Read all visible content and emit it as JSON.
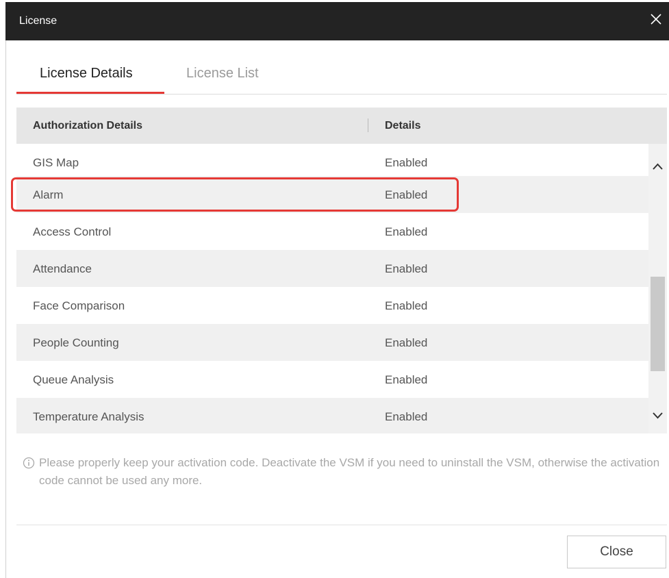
{
  "dialog": {
    "title": "License"
  },
  "tabs": [
    {
      "label": "License Details",
      "active": true
    },
    {
      "label": "License List",
      "active": false
    }
  ],
  "table": {
    "headers": [
      "Authorization Details",
      "Details"
    ],
    "rows": [
      {
        "name": "GIS Map",
        "status": "Enabled"
      },
      {
        "name": "Alarm",
        "status": "Enabled",
        "highlighted": true
      },
      {
        "name": "Access Control",
        "status": "Enabled"
      },
      {
        "name": "Attendance",
        "status": "Enabled"
      },
      {
        "name": "Face Comparison",
        "status": "Enabled"
      },
      {
        "name": "People Counting",
        "status": "Enabled"
      },
      {
        "name": "Queue Analysis",
        "status": "Enabled"
      },
      {
        "name": "Temperature Analysis",
        "status": "Enabled"
      }
    ]
  },
  "notice": {
    "text": "Please properly keep your activation code. Deactivate the VSM if you need to uninstall the VSM, otherwise the activation code cannot be used any more."
  },
  "footer": {
    "close_label": "Close"
  },
  "colors": {
    "accent": "#e53935",
    "titlebar": "#232323",
    "header_bg": "#e6e6e6",
    "row_alt": "#f0f0f0"
  },
  "icons": {
    "close": "close-icon",
    "info": "info-icon",
    "scroll_up": "chevron-up-icon",
    "scroll_down": "chevron-down-icon"
  }
}
